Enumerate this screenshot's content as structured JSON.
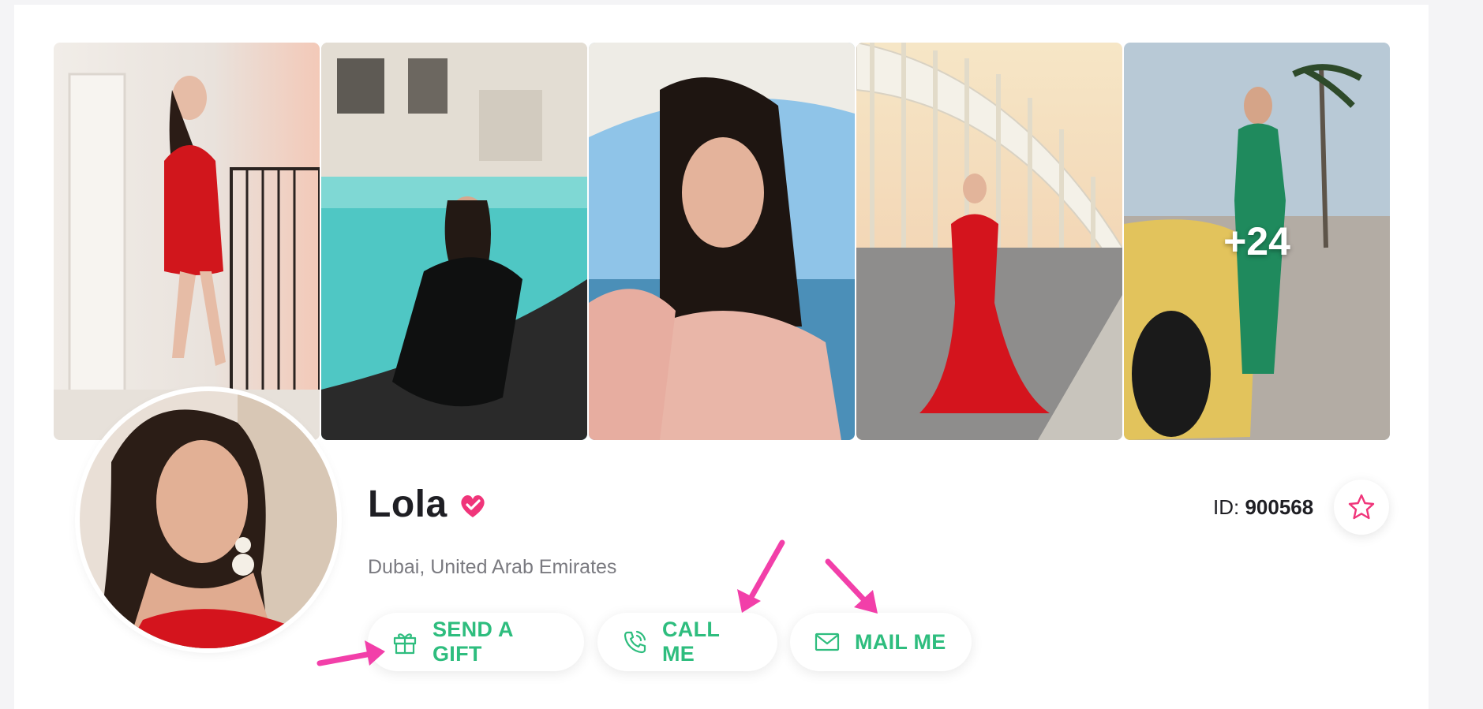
{
  "gallery": {
    "more_count": "+24",
    "photos": [
      {
        "icon": "photo-red-dress-balcony"
      },
      {
        "icon": "photo-black-dress-pool"
      },
      {
        "icon": "photo-pink-dress-boat"
      },
      {
        "icon": "photo-red-gown-bridge"
      },
      {
        "icon": "photo-green-dress-car"
      }
    ]
  },
  "profile": {
    "name": "Lola",
    "location": "Dubai, United Arab Emirates",
    "id_label": "ID:",
    "id_value": "900568",
    "verified_icon": "verified-heart-icon",
    "favorite_icon": "star-icon"
  },
  "actions": {
    "gift": {
      "label": "SEND A GIFT",
      "icon": "gift-icon"
    },
    "call": {
      "label": "CALL ME",
      "icon": "phone-icon"
    },
    "mail": {
      "label": "MAIL ME",
      "icon": "mail-icon"
    }
  },
  "colors": {
    "accent_green": "#2ebd7e",
    "accent_pink": "#f0357a",
    "annotation_arrow": "#f23fa9"
  }
}
